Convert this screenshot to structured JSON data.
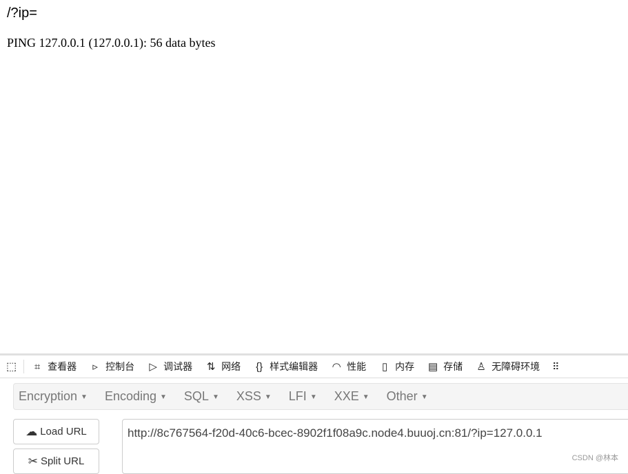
{
  "page": {
    "path": "/?ip=",
    "output": "PING 127.0.0.1 (127.0.0.1): 56 data bytes"
  },
  "devtools": {
    "tabs": [
      {
        "icon": "inspector-icon",
        "label": "查看器"
      },
      {
        "icon": "console-icon",
        "label": "控制台"
      },
      {
        "icon": "debugger-icon",
        "label": "调试器"
      },
      {
        "icon": "network-icon",
        "label": "网络"
      },
      {
        "icon": "style-editor-icon",
        "label": "样式编辑器"
      },
      {
        "icon": "performance-icon",
        "label": "性能"
      },
      {
        "icon": "memory-icon",
        "label": "内存"
      },
      {
        "icon": "storage-icon",
        "label": "存储"
      },
      {
        "icon": "accessibility-icon",
        "label": "无障碍环境"
      }
    ]
  },
  "hackbar": {
    "menus": [
      "Encryption",
      "Encoding",
      "SQL",
      "XSS",
      "LFI",
      "XXE",
      "Other"
    ],
    "load_url": "Load URL",
    "split_url": "Split URL",
    "url": "http://8c767564-f20d-40c6-bcec-8902f1f08a9c.node4.buuoj.cn:81/?ip=127.0.0.1"
  },
  "watermark": "CSDN @林本"
}
